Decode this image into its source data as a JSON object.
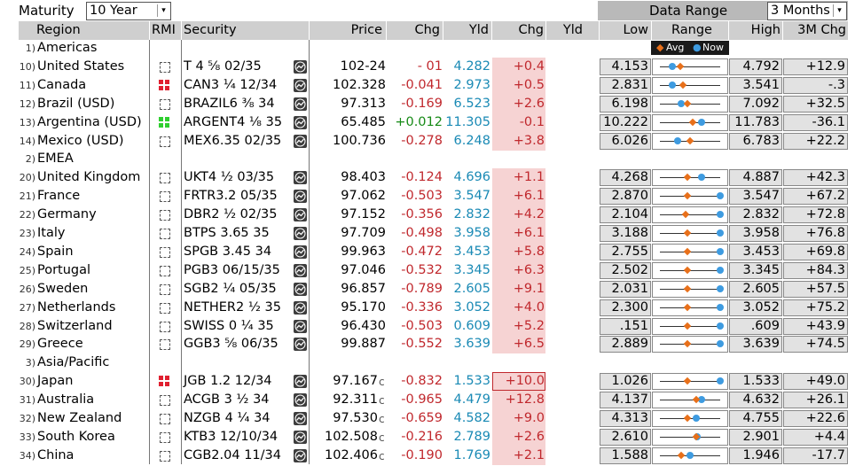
{
  "toolbar": {
    "maturity_label": "Maturity",
    "maturity_value": "10 Year",
    "data_range_label": "Data Range",
    "data_range_value": "3 Months"
  },
  "headers": {
    "region": "Region",
    "rmi": "RMI",
    "security": "Security",
    "price": "Price",
    "chg": "Chg",
    "yld": "Yld",
    "chg2": "Chg",
    "yld2": "Yld",
    "low": "Low",
    "range": "Range",
    "high": "High",
    "chg3m": "3M Chg"
  },
  "legend": {
    "avg": "Avg",
    "now": "Now"
  },
  "colors": {
    "avg": "#e8701a",
    "now": "#3e9be0",
    "chg_bg": "#f6d3d3",
    "up_red": "#c0282d",
    "green": "#168a16",
    "yield_blue": "#1a8ab5"
  },
  "rows": [
    {
      "type": "group",
      "num": "1)",
      "name": "Americas"
    },
    {
      "type": "data",
      "num": "10)",
      "name": "United States",
      "rmi": "none",
      "security": "T 4 ⅝ 02/35",
      "price": "102-24",
      "chg": "- 01",
      "chg_color": "red",
      "yld": "4.282",
      "ychg": "+0.4",
      "low": "4.153",
      "high": "4.792",
      "chg3m": "+12.9",
      "avg": 0.34,
      "now": 0.2,
      "c": ""
    },
    {
      "type": "data",
      "num": "11)",
      "name": "Canada",
      "rmi": "red",
      "security": "CAN3 ¼ 12/34",
      "price": "102.328",
      "chg": "-0.041",
      "chg_color": "red",
      "yld": "2.973",
      "ychg": "+0.5",
      "low": "2.831",
      "high": "3.541",
      "chg3m": "-.3",
      "avg": 0.38,
      "now": 0.2,
      "c": ""
    },
    {
      "type": "data",
      "num": "12)",
      "name": "Brazil (USD)",
      "rmi": "none",
      "security": "BRAZIL6 ⅜ 34",
      "price": "97.313",
      "chg": "-0.169",
      "chg_color": "red",
      "yld": "6.523",
      "ychg": "+2.6",
      "low": "6.198",
      "high": "7.092",
      "chg3m": "+32.5",
      "avg": 0.45,
      "now": 0.36,
      "c": ""
    },
    {
      "type": "data",
      "num": "13)",
      "name": "Argentina (USD)",
      "rmi": "green",
      "security": "ARGENT4 ⅛ 35",
      "price": "65.485",
      "chg": "+0.012",
      "chg_color": "green",
      "yld": "11.305",
      "ychg": "-0.1",
      "low": "10.222",
      "high": "11.783",
      "chg3m": "-36.1",
      "avg": 0.55,
      "now": 0.69,
      "c": ""
    },
    {
      "type": "data",
      "num": "14)",
      "name": "Mexico (USD)",
      "rmi": "none",
      "security": "MEX6.35 02/35",
      "price": "100.736",
      "chg": "-0.278",
      "chg_color": "red",
      "yld": "6.248",
      "ychg": "+3.8",
      "low": "6.026",
      "high": "6.783",
      "chg3m": "+22.2",
      "avg": 0.5,
      "now": 0.3,
      "c": ""
    },
    {
      "type": "group",
      "num": "2)",
      "name": "EMEA"
    },
    {
      "type": "data",
      "num": "20)",
      "name": "United Kingdom",
      "rmi": "none",
      "security": "UKT4 ½ 03/35",
      "price": "98.403",
      "chg": "-0.124",
      "chg_color": "red",
      "yld": "4.696",
      "ychg": "+1.1",
      "low": "4.268",
      "high": "4.887",
      "chg3m": "+42.3",
      "avg": 0.45,
      "now": 0.69,
      "c": ""
    },
    {
      "type": "data",
      "num": "21)",
      "name": "France",
      "rmi": "none",
      "security": "FRTR3.2 05/35",
      "price": "97.062",
      "chg": "-0.503",
      "chg_color": "red",
      "yld": "3.547",
      "ychg": "+6.1",
      "low": "2.870",
      "high": "3.547",
      "chg3m": "+67.2",
      "avg": 0.45,
      "now": 1.0,
      "c": ""
    },
    {
      "type": "data",
      "num": "22)",
      "name": "Germany",
      "rmi": "none",
      "security": "DBR2 ½ 02/35",
      "price": "97.152",
      "chg": "-0.356",
      "chg_color": "red",
      "yld": "2.832",
      "ychg": "+4.2",
      "low": "2.104",
      "high": "2.832",
      "chg3m": "+72.8",
      "avg": 0.42,
      "now": 1.0,
      "c": ""
    },
    {
      "type": "data",
      "num": "23)",
      "name": "Italy",
      "rmi": "none",
      "security": "BTPS 3.65 35",
      "price": "97.709",
      "chg": "-0.498",
      "chg_color": "red",
      "yld": "3.958",
      "ychg": "+6.1",
      "low": "3.188",
      "high": "3.958",
      "chg3m": "+76.8",
      "avg": 0.45,
      "now": 1.0,
      "c": ""
    },
    {
      "type": "data",
      "num": "24)",
      "name": "Spain",
      "rmi": "none",
      "security": "SPGB 3.45 34",
      "price": "99.963",
      "chg": "-0.472",
      "chg_color": "red",
      "yld": "3.453",
      "ychg": "+5.8",
      "low": "2.755",
      "high": "3.453",
      "chg3m": "+69.8",
      "avg": 0.45,
      "now": 1.0,
      "c": ""
    },
    {
      "type": "data",
      "num": "25)",
      "name": "Portugal",
      "rmi": "none",
      "security": "PGB3 06/15/35",
      "price": "97.046",
      "chg": "-0.532",
      "chg_color": "red",
      "yld": "3.345",
      "ychg": "+6.3",
      "low": "2.502",
      "high": "3.345",
      "chg3m": "+84.3",
      "avg": 0.45,
      "now": 1.0,
      "c": ""
    },
    {
      "type": "data",
      "num": "26)",
      "name": "Sweden",
      "rmi": "none",
      "security": "SGB2 ¼ 05/35",
      "price": "96.857",
      "chg": "-0.789",
      "chg_color": "red",
      "yld": "2.605",
      "ychg": "+9.1",
      "low": "2.031",
      "high": "2.605",
      "chg3m": "+57.5",
      "avg": 0.45,
      "now": 1.0,
      "c": ""
    },
    {
      "type": "data",
      "num": "27)",
      "name": "Netherlands",
      "rmi": "none",
      "security": "NETHER2 ½ 35",
      "price": "95.170",
      "chg": "-0.336",
      "chg_color": "red",
      "yld": "3.052",
      "ychg": "+4.0",
      "low": "2.300",
      "high": "3.052",
      "chg3m": "+75.2",
      "avg": 0.45,
      "now": 1.0,
      "c": ""
    },
    {
      "type": "data",
      "num": "28)",
      "name": "Switzerland",
      "rmi": "none",
      "security": "SWISS 0 ¼ 35",
      "price": "96.430",
      "chg": "-0.503",
      "chg_color": "red",
      "yld": "0.609",
      "ychg": "+5.2",
      "low": ".151",
      "high": ".609",
      "chg3m": "+43.9",
      "avg": 0.45,
      "now": 1.0,
      "c": ""
    },
    {
      "type": "data",
      "num": "29)",
      "name": "Greece",
      "rmi": "none",
      "security": "GGB3 ⅝ 06/35",
      "price": "99.887",
      "chg": "-0.552",
      "chg_color": "red",
      "yld": "3.639",
      "ychg": "+6.5",
      "low": "2.889",
      "high": "3.639",
      "chg3m": "+74.5",
      "avg": 0.45,
      "now": 1.0,
      "c": ""
    },
    {
      "type": "group",
      "num": "3)",
      "name": "Asia/Pacific"
    },
    {
      "type": "data",
      "num": "30)",
      "name": "Japan",
      "rmi": "red",
      "security": "JGB 1.2 12/34",
      "price": "97.167",
      "chg": "-0.832",
      "chg_color": "red",
      "yld": "1.533",
      "ychg": "+10.0",
      "low": "1.026",
      "high": "1.533",
      "chg3m": "+49.0",
      "avg": 0.45,
      "now": 1.0,
      "c": "c",
      "highlight": true
    },
    {
      "type": "data",
      "num": "31)",
      "name": "Australia",
      "rmi": "none",
      "security": "ACGB 3 ½ 34",
      "price": "92.311",
      "chg": "-0.965",
      "chg_color": "red",
      "yld": "4.479",
      "ychg": "+12.8",
      "low": "4.137",
      "high": "4.632",
      "chg3m": "+26.1",
      "avg": 0.6,
      "now": 0.69,
      "c": "c"
    },
    {
      "type": "data",
      "num": "32)",
      "name": "New Zealand",
      "rmi": "none",
      "security": "NZGB 4 ¼ 34",
      "price": "97.530",
      "chg": "-0.659",
      "chg_color": "red",
      "yld": "4.582",
      "ychg": "+9.0",
      "low": "4.313",
      "high": "4.755",
      "chg3m": "+22.6",
      "avg": 0.45,
      "now": 0.6,
      "c": "c"
    },
    {
      "type": "data",
      "num": "33)",
      "name": "South Korea",
      "rmi": "none",
      "security": "KTB3 12/10/34",
      "price": "102.508",
      "chg": "-0.216",
      "chg_color": "red",
      "yld": "2.789",
      "ychg": "+2.6",
      "low": "2.610",
      "high": "2.901",
      "chg3m": "+4.4",
      "avg": 0.6,
      "now": 0.62,
      "c": "c"
    },
    {
      "type": "data",
      "num": "34)",
      "name": "China",
      "rmi": "none",
      "security": "CGB2.04 11/34",
      "price": "102.406",
      "chg": "-0.190",
      "chg_color": "red",
      "yld": "1.769",
      "ychg": "+2.1",
      "low": "1.588",
      "high": "1.946",
      "chg3m": "-17.7",
      "avg": 0.35,
      "now": 0.5,
      "c": "c"
    }
  ]
}
